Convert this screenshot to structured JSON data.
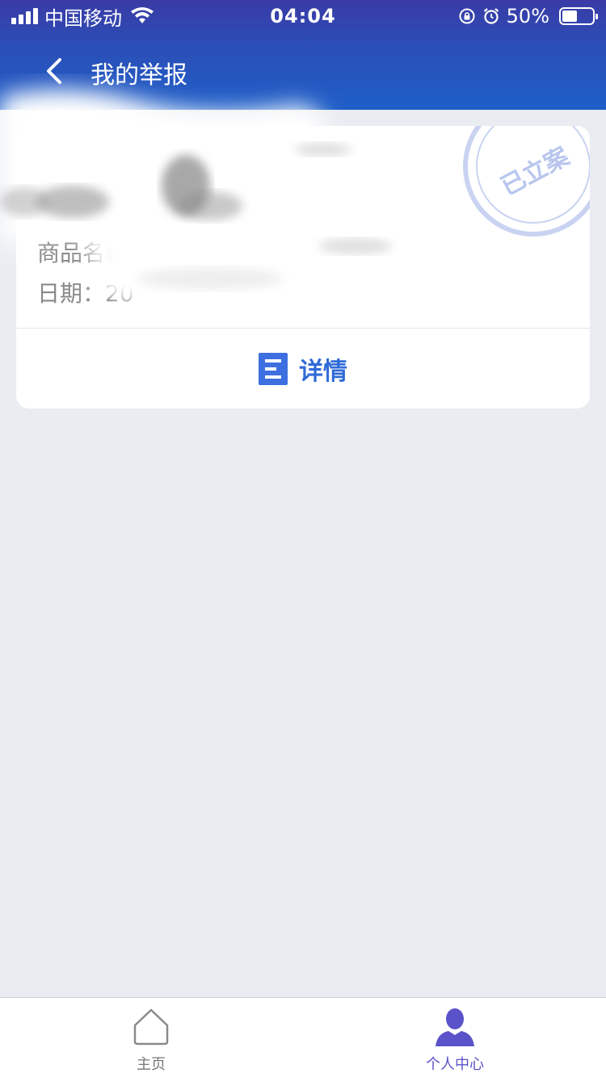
{
  "status_bar": {
    "carrier": "中国移动",
    "time": "04:04",
    "battery": "50%",
    "battery_level": 0.5
  },
  "nav": {
    "title": "我的举报"
  },
  "report_card": {
    "stamp_text": "已立案",
    "name_label": "商品名称",
    "name_value": "",
    "date_label": "日期：",
    "date_value": "20",
    "detail_label": "详情"
  },
  "tabbar": {
    "home_label": "主页",
    "me_label": "个人中心",
    "active": "me"
  },
  "colors": {
    "header": "#2b4fb8",
    "accent": "#2f6bd8",
    "tab_active": "#5a52c9",
    "background": "#e9ecf1"
  },
  "icons": {
    "back": "chevron-left-icon",
    "detail": "document-icon",
    "home": "home-icon",
    "me": "person-icon"
  }
}
